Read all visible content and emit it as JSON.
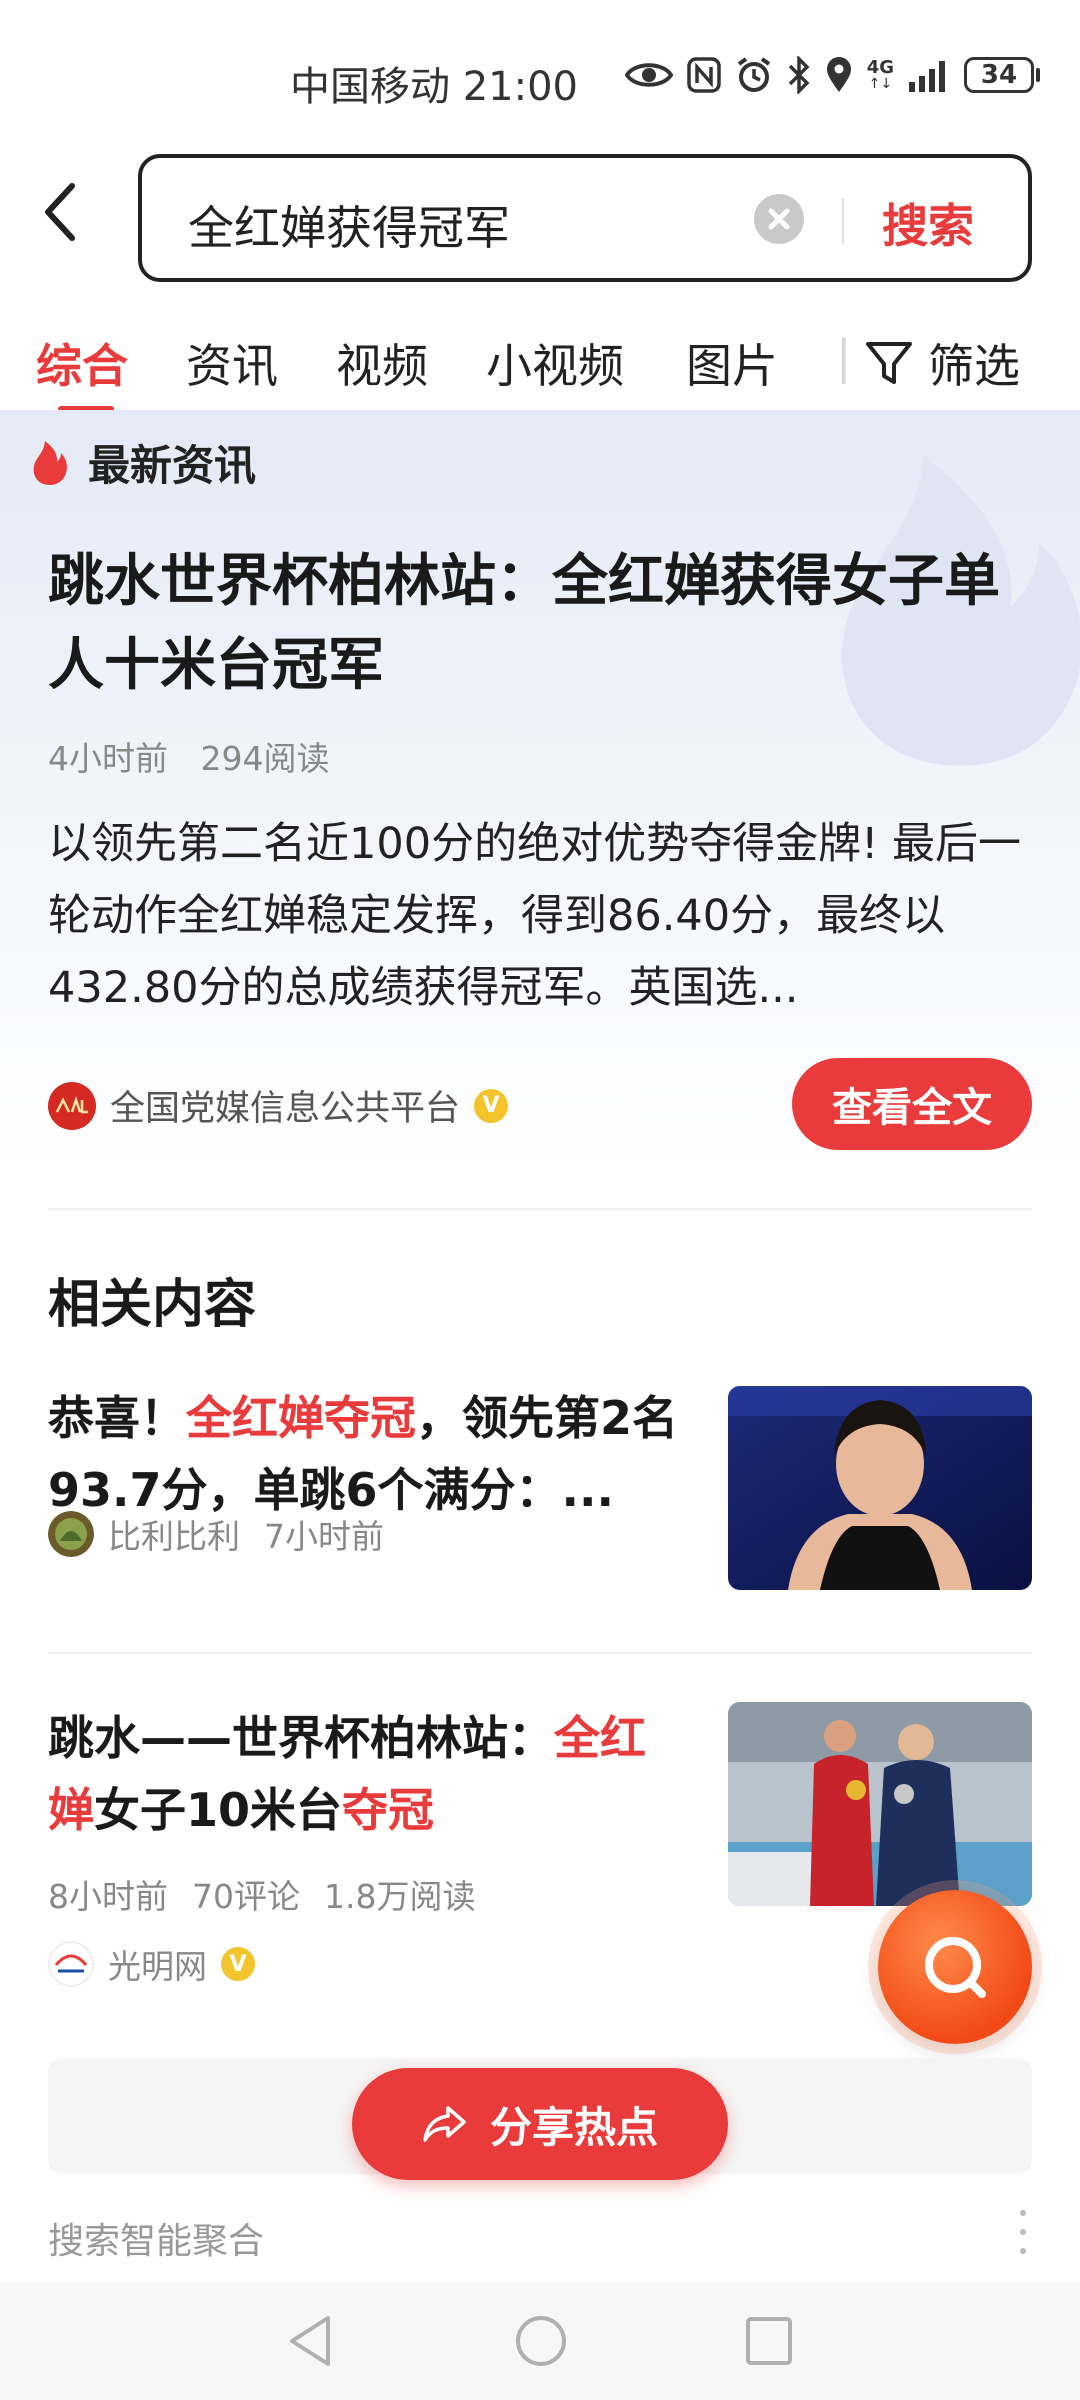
{
  "status_bar": {
    "carrier_time": "中国移动 21:00",
    "network": "4G",
    "battery": "34"
  },
  "search": {
    "query": "全红婵获得冠军",
    "button_label": "搜索"
  },
  "tabs": [
    {
      "label": "综合",
      "active": true
    },
    {
      "label": "资讯",
      "active": false
    },
    {
      "label": "视频",
      "active": false
    },
    {
      "label": "小视频",
      "active": false
    },
    {
      "label": "图片",
      "active": false
    }
  ],
  "filter_label": "筛选",
  "latest_news": {
    "tag": "最新资讯",
    "title": "跳水世界杯柏林站：全红婵获得女子单人十米台冠军",
    "time": "4小时前",
    "reads": "294阅读",
    "summary": "以领先第二名近100分的绝对优势夺得金牌! 最后一轮动作全红婵稳定发挥，得到86.40分，最终以432.80分的总成绩获得冠军。英国选...",
    "source": "全国党媒信息公共平台",
    "read_full_label": "查看全文"
  },
  "related": {
    "title": "相关内容",
    "items": [
      {
        "title_pre": "恭喜！",
        "title_hl": "全红婵夺冠",
        "title_post": "，领先第2名93.7分，单跳6个满分：...",
        "source": "比利比利",
        "time": "7小时前"
      },
      {
        "title_pre": "跳水——世界杯柏林站：",
        "title_hl": "全红婵",
        "title_mid": "女子10米台",
        "title_hl2": "夺冠",
        "time": "8小时前",
        "comments": "70评论",
        "reads": "1.8万阅读",
        "source": "光明网"
      }
    ]
  },
  "share_label": "分享热点",
  "aggregate_label": "搜索智能聚合",
  "colors": {
    "accent": "#e93b3b",
    "fab": "#f24a16"
  }
}
